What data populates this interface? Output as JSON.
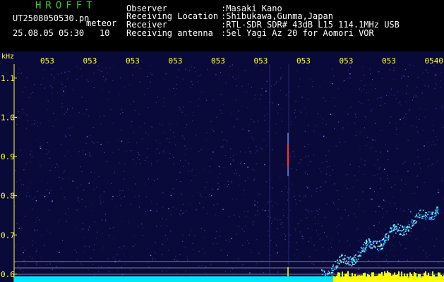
{
  "header": {
    "logo": "HROFFT",
    "filename": "UT2508050530.pn",
    "event_type": "meteor",
    "datetime": "25.08.05 05:30",
    "count": "10",
    "rows": [
      {
        "label": "Observer",
        "value": ":Masaki Kano"
      },
      {
        "label": "Receiving Location",
        "value": ":Shibukawa,Gunma,Japan"
      },
      {
        "label": "Receiver",
        "value": ":RTL-SDR SDR# 43dB L15 114.1MHz USB"
      },
      {
        "label": "Receiving antenna",
        "value": ":5el Yagi Az 20 for Aomori VOR"
      }
    ]
  },
  "spectrogram": {
    "unit_label": "kHz",
    "time_ticks": [
      "053",
      "053",
      "053",
      "053",
      "053",
      "053",
      "053",
      "053",
      "053",
      "0540"
    ],
    "freq_ticks": [
      {
        "label": "1.1",
        "value": 1.1
      },
      {
        "label": "1.0",
        "value": 1.0
      },
      {
        "label": "0.9",
        "value": 0.9
      },
      {
        "label": "0.8",
        "value": 0.8
      },
      {
        "label": "0.7",
        "value": 0.7
      },
      {
        "label": "0.6",
        "value": 0.6
      }
    ],
    "freq_range": [
      0.58,
      1.15
    ],
    "colors": {
      "background": "#0a0a3a",
      "noise": "#2a3aa8",
      "text": "#ffff33",
      "meteor": "#ff3030",
      "trace": "#33ffff",
      "baseline": "#00e5ff",
      "baseline_peak": "#ffff00"
    }
  }
}
